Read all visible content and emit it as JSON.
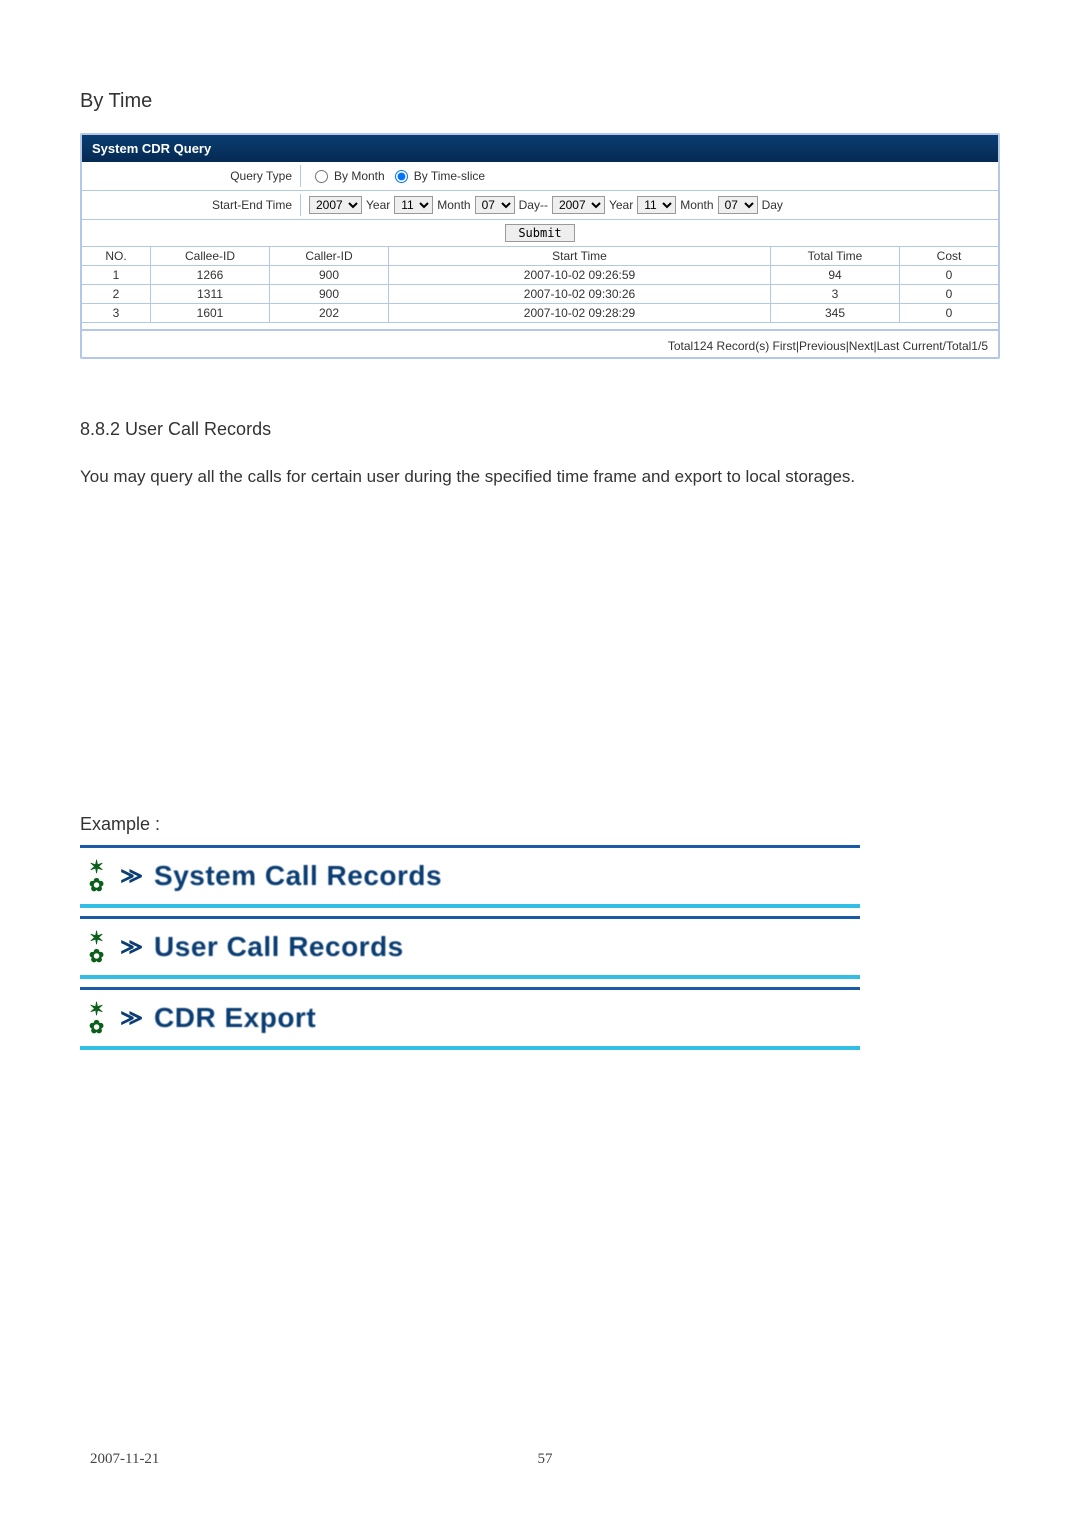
{
  "section_title": "By Time",
  "panel": {
    "title": "System CDR Query",
    "query_type_label": "Query Type",
    "by_month_label": "By Month",
    "by_time_slice_label": "By Time-slice",
    "start_end_label": "Start-End Time",
    "start": {
      "year": "2007",
      "month": "11",
      "day": "07"
    },
    "end": {
      "year": "2007",
      "month": "11",
      "day": "07"
    },
    "labels": {
      "year": "Year",
      "month": "Month",
      "day": "Day",
      "sep": "Day--"
    },
    "submit_label": "Submit"
  },
  "table": {
    "headers": [
      "NO.",
      "Callee-ID",
      "Caller-ID",
      "Start Time",
      "Total Time",
      "Cost"
    ],
    "rows": [
      [
        "1",
        "1266",
        "900",
        "2007-10-02 09:26:59",
        "94",
        "0"
      ],
      [
        "2",
        "1311",
        "900",
        "2007-10-02 09:30:26",
        "3",
        "0"
      ],
      [
        "3",
        "1601",
        "202",
        "2007-10-02 09:28:29",
        "345",
        "0"
      ]
    ],
    "pager": "Total124 Record(s)  First|Previous|Next|Last  Current/Total1/5"
  },
  "subsection": {
    "title": "8.8.2 User Call Records",
    "body": "You may query all the calls for certain user during the specified time frame and export to local storages."
  },
  "example_label": "Example :",
  "nav_items": [
    "System Call Records",
    "User Call Records",
    "CDR Export"
  ],
  "footer": {
    "date": "2007-11-21",
    "page": "57"
  }
}
